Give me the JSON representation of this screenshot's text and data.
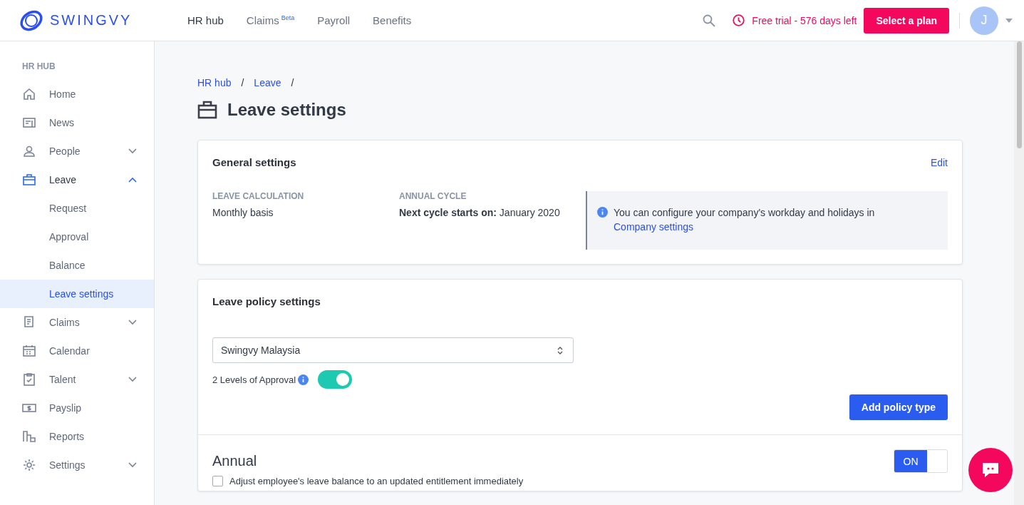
{
  "brand": "SWINGVY",
  "nav": [
    {
      "label": "HR hub",
      "selected": true
    },
    {
      "label": "Claims",
      "selected": false,
      "badge": "Beta"
    },
    {
      "label": "Payroll",
      "selected": false
    },
    {
      "label": "Benefits",
      "selected": false
    }
  ],
  "trial": "Free trial - 576 days left",
  "plan_button": "Select a plan",
  "avatar": "J",
  "sidebar": {
    "heading": "HR HUB",
    "items": [
      {
        "label": "Home",
        "selected": false
      },
      {
        "label": "News",
        "selected": false
      },
      {
        "label": "People",
        "selected": false,
        "expanded": false
      },
      {
        "label": "Leave",
        "selected": true,
        "expanded": true,
        "children": [
          {
            "label": "Request",
            "selected": false
          },
          {
            "label": "Approval",
            "selected": false
          },
          {
            "label": "Balance",
            "selected": false
          },
          {
            "label": "Leave settings",
            "selected": true
          }
        ]
      },
      {
        "label": "Claims",
        "selected": false,
        "expanded": false
      },
      {
        "label": "Calendar",
        "selected": false
      },
      {
        "label": "Talent",
        "selected": false,
        "expanded": false
      },
      {
        "label": "Payslip",
        "selected": false
      },
      {
        "label": "Reports",
        "selected": false
      },
      {
        "label": "Settings",
        "selected": false,
        "expanded": false
      }
    ]
  },
  "breadcrumb": [
    {
      "label": "HR hub",
      "separator": "/"
    },
    {
      "label": "Leave",
      "separator": "/"
    }
  ],
  "page_title": "Leave settings",
  "general": {
    "title": "General settings",
    "edit": "Edit",
    "calc_label": "LEAVE CALCULATION",
    "calc_value": "Monthly basis",
    "cycle_label": "ANNUAL CYCLE",
    "cycle_key": "Next cycle starts on:",
    "cycle_value": "January 2020",
    "info": "You can configure your company's workday and holidays in",
    "info_link": "Company settings"
  },
  "policy": {
    "title": "Leave policy settings",
    "select": "Swingvy Malaysia",
    "approval_label": "2 Levels of Approval",
    "approval_on": true,
    "add_button": "Add policy type"
  },
  "annual": {
    "title": "Annual",
    "toggle": "ON",
    "on": true,
    "adjust_label": "Adjust employee's leave balance to an updated entitlement immediately",
    "adjust_checked": false
  }
}
